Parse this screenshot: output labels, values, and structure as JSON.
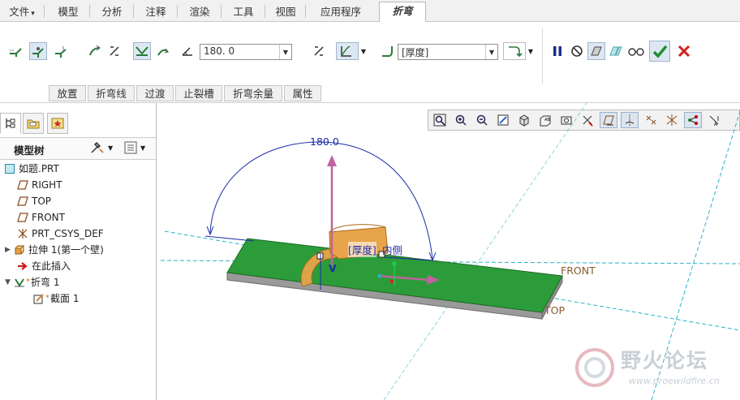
{
  "menu": {
    "file": "文件",
    "file_arrow": "▾",
    "tabs": [
      "模型",
      "分析",
      "注释",
      "渲染",
      "工具",
      "视图",
      "应用程序"
    ],
    "active_tab": "折弯"
  },
  "ribbon": {
    "angle_value": "180. 0",
    "thickness_value": "[厚度]",
    "subtabs": [
      "放置",
      "折弯线",
      "过渡",
      "止裂槽",
      "折弯余量",
      "属性"
    ]
  },
  "panel": {
    "title": "模型树"
  },
  "tree": [
    {
      "label": "如题.PRT",
      "icon": "part-icon"
    },
    {
      "label": "RIGHT",
      "icon": "datum-plane-icon"
    },
    {
      "label": "TOP",
      "icon": "datum-plane-icon"
    },
    {
      "label": "FRONT",
      "icon": "datum-plane-icon"
    },
    {
      "label": "PRT_CSYS_DEF",
      "icon": "csys-icon"
    },
    {
      "label": "拉伸 1(第一个壁)",
      "icon": "extrude-icon"
    },
    {
      "label": "在此插入",
      "icon": "insert-here-icon"
    },
    {
      "label": "折弯 1",
      "icon": "bend-icon",
      "marker": "*"
    },
    {
      "label": "截面 1",
      "icon": "sketch-icon",
      "marker": "*"
    }
  ],
  "viewport": {
    "angle_label": "180.0",
    "thickness_label": "[厚度]",
    "inside_label": "内侧",
    "v_label": "V",
    "front_label": "FRONT",
    "top_label": "TOP"
  },
  "watermark": {
    "title": "野火论坛",
    "url": "www.proewildfire.cn"
  },
  "colors": {
    "sheet_green": "#2c9c3a",
    "bend_orange": "#e8a44a",
    "arrow_pink": "#c0639e",
    "dim_blue": "#1a2aa8",
    "datum_cyan": "#2ab2c8"
  }
}
